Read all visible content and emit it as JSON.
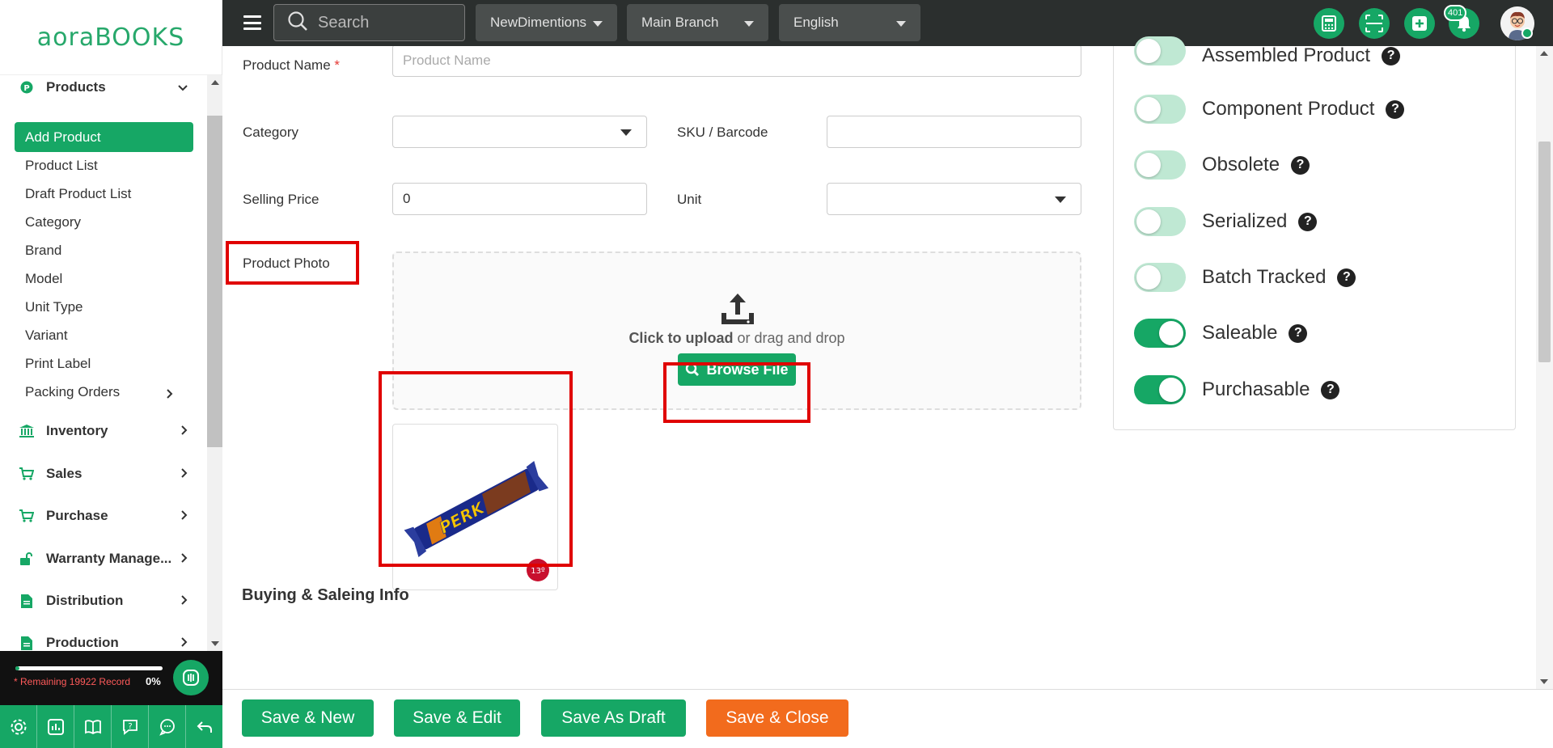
{
  "brand": {
    "logo_part1": "aora",
    "logo_part2": "BOOKS"
  },
  "topbar": {
    "search_placeholder": "Search",
    "company": "NewDimentions",
    "branch": "Main Branch",
    "language": "English",
    "notification_count": "401",
    "icons": [
      "hamburger-icon",
      "search-icon",
      "calculator-icon",
      "scanner-icon",
      "add-icon",
      "bell-icon",
      "avatar"
    ]
  },
  "sidebar": {
    "products": {
      "label": "Products",
      "items": [
        {
          "label": "Add Product",
          "active": true
        },
        {
          "label": "Product List"
        },
        {
          "label": "Draft Product List"
        },
        {
          "label": "Category"
        },
        {
          "label": "Brand"
        },
        {
          "label": "Model"
        },
        {
          "label": "Unit Type"
        },
        {
          "label": "Variant"
        },
        {
          "label": "Print Label"
        },
        {
          "label": "Packing Orders"
        }
      ]
    },
    "groups": [
      {
        "label": "Inventory"
      },
      {
        "label": "Sales"
      },
      {
        "label": "Purchase"
      },
      {
        "label": "Warranty Manage..."
      },
      {
        "label": "Distribution"
      },
      {
        "label": "Production"
      }
    ],
    "remaining_text": "* Remaining 19922 Record",
    "progress_pct_text": "0%",
    "progress_fraction": 0.03
  },
  "form": {
    "product_name_label": "Product Name",
    "required_mark": "*",
    "product_name_placeholder": "Product Name",
    "category_label": "Category",
    "sku_label": "SKU / Barcode",
    "selling_price_label": "Selling Price",
    "selling_price_value": "0",
    "unit_label": "Unit",
    "product_photo_label": "Product Photo",
    "upload_bold": "Click to upload",
    "upload_rest": " or drag and drop",
    "browse_label": "Browse File",
    "thumb_brand_text": "PERK",
    "thumb_badge_text": "13º",
    "section_title": "Buying & Saleing Info"
  },
  "flags": [
    {
      "label": "Assembled Product",
      "on": false
    },
    {
      "label": "Component Product",
      "on": false
    },
    {
      "label": "Obsolete",
      "on": false
    },
    {
      "label": "Serialized",
      "on": false
    },
    {
      "label": "Batch Tracked",
      "on": false
    },
    {
      "label": "Saleable",
      "on": true
    },
    {
      "label": "Purchasable",
      "on": true
    }
  ],
  "footer": {
    "save_new": "Save & New",
    "save_edit": "Save & Edit",
    "save_draft": "Save As Draft",
    "save_close": "Save & Close"
  },
  "colors": {
    "primary": "#16a765",
    "accent": "#f26b1d",
    "topbar": "#2b2f2e",
    "highlight": "#e00000"
  }
}
